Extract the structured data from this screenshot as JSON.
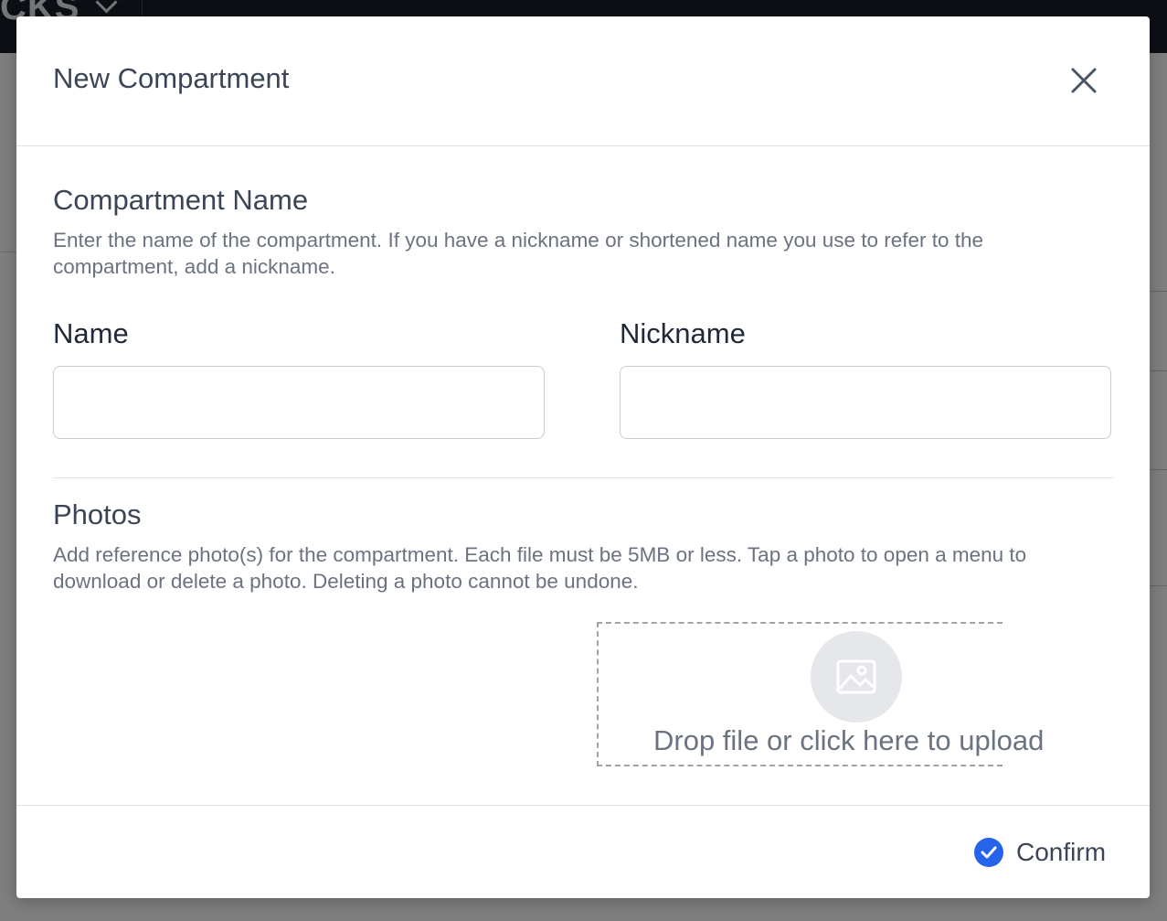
{
  "background": {
    "brand": "CKS"
  },
  "modal": {
    "title": "New Compartment",
    "close_icon": "close-icon",
    "name_section": {
      "title": "Compartment Name",
      "description": "Enter the name of the compartment. If you have a nickname or shortened name you use to refer to the compartment, add a nickname.",
      "name_label": "Name",
      "name_value": "",
      "nickname_label": "Nickname",
      "nickname_value": ""
    },
    "photos_section": {
      "title": "Photos",
      "description": "Add reference photo(s) for the compartment. Each file must be 5MB or less. Tap a photo to open a menu to download or delete a photo. Deleting a photo cannot be undone.",
      "dropzone_icon": "image-icon",
      "dropzone_text": "Drop file or click here to upload"
    },
    "footer": {
      "confirm_label": "Confirm",
      "confirm_icon": "check-circle-icon"
    }
  },
  "colors": {
    "accent": "#2563eb",
    "title_text": "#3b4556",
    "muted_text": "#6b7280",
    "topbar": "#1a1f2b"
  }
}
